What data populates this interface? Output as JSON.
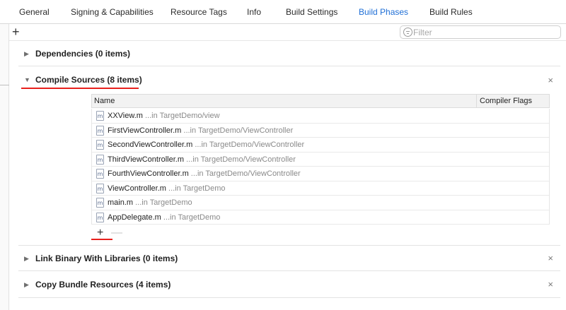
{
  "tabs": [
    {
      "label": "General",
      "active": false
    },
    {
      "label": "Signing & Capabilities",
      "active": false
    },
    {
      "label": "Resource Tags",
      "active": false
    },
    {
      "label": "Info",
      "active": false
    },
    {
      "label": "Build Settings",
      "active": false
    },
    {
      "label": "Build Phases",
      "active": true
    },
    {
      "label": "Build Rules",
      "active": false
    }
  ],
  "toolbar": {
    "add_label": "+",
    "filter_placeholder": "Filter",
    "filter_value": ""
  },
  "phases": {
    "dependencies": {
      "title": "Dependencies (0 items)",
      "disclosure": "▶",
      "expanded": false
    },
    "compile_sources": {
      "title": "Compile Sources (8 items)",
      "disclosure": "▼",
      "expanded": true,
      "close": "×"
    },
    "link_binary": {
      "title": "Link Binary With Libraries (0 items)",
      "disclosure": "▶",
      "expanded": false,
      "close": "×"
    },
    "copy_bundle": {
      "title": "Copy Bundle Resources (4 items)",
      "disclosure": "▶",
      "expanded": false,
      "close": "×"
    }
  },
  "table": {
    "columns": {
      "name": "Name",
      "flags": "Compiler Flags"
    },
    "icon_glyph": "m",
    "rows": [
      {
        "file": "XXView.m",
        "path": "...in TargetDemo/view"
      },
      {
        "file": "FirstViewController.m",
        "path": "...in TargetDemo/ViewController"
      },
      {
        "file": "SecondViewController.m",
        "path": "...in TargetDemo/ViewController"
      },
      {
        "file": "ThirdViewController.m",
        "path": "...in TargetDemo/ViewController"
      },
      {
        "file": "FourthViewController.m",
        "path": "...in TargetDemo/ViewController"
      },
      {
        "file": "ViewController.m",
        "path": "...in TargetDemo"
      },
      {
        "file": "main.m",
        "path": "...in TargetDemo"
      },
      {
        "file": "AppDelegate.m",
        "path": "...in TargetDemo"
      }
    ],
    "add_label": "+",
    "remove_label": "—"
  },
  "colors": {
    "active_tab": "#1f6fd6",
    "annotation_red": "#e8201c"
  }
}
